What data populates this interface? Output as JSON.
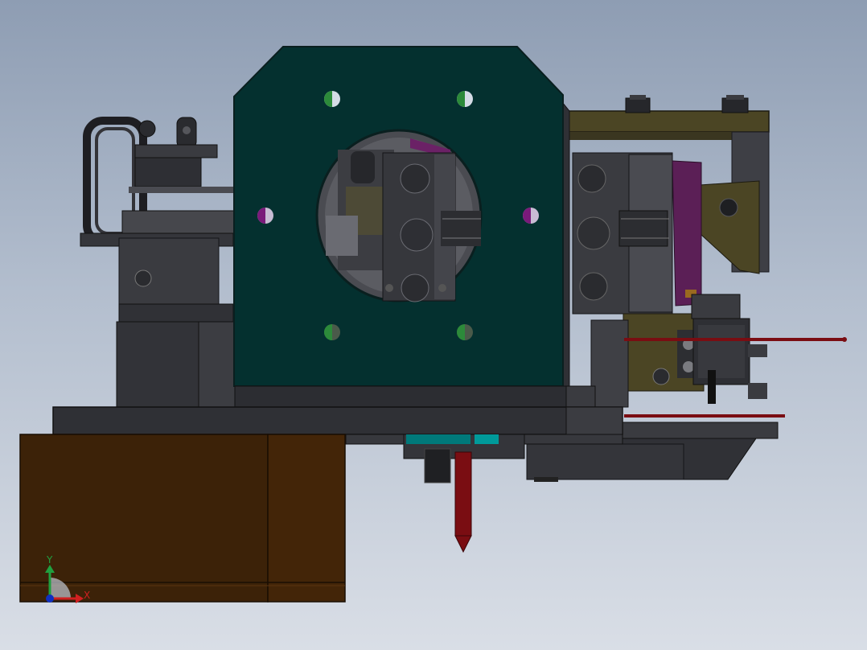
{
  "viewport": {
    "background_top": "#8e9db3",
    "background_bottom": "#d9dee6"
  },
  "model": {
    "colors": {
      "front_plate": "#04302f",
      "front_plate_edge": "#0a1f1f",
      "dark_steel": "#2f3035",
      "mid_steel": "#45464c",
      "light_steel": "#5d5e63",
      "base_block": "#3c2208",
      "base_block_side": "#432508",
      "olive_bracket": "#4b4524",
      "purple_plate": "#5b1f56",
      "rod_red": "#7a0d12",
      "teal_accent": "#00797a"
    }
  },
  "triad": {
    "x_label": "X",
    "y_label": "Y",
    "x_color": "#d02020",
    "y_color": "#20a040",
    "z_color": "#1030c0"
  }
}
